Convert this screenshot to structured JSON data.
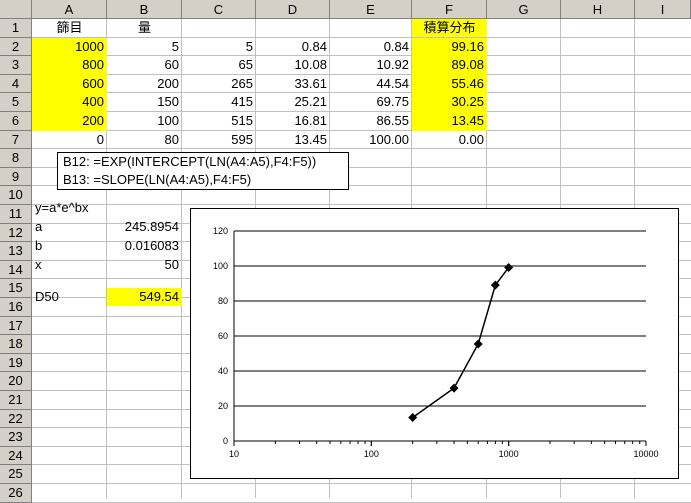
{
  "columns": [
    "A",
    "B",
    "C",
    "D",
    "E",
    "F",
    "G",
    "H",
    "I"
  ],
  "rows": [
    "1",
    "2",
    "3",
    "4",
    "5",
    "6",
    "7",
    "8",
    "9",
    "10",
    "11",
    "12",
    "13",
    "14",
    "15",
    "16",
    "17",
    "18",
    "19",
    "20",
    "21",
    "22",
    "23",
    "24",
    "25",
    "26"
  ],
  "header_row": {
    "A": "篩目",
    "B": "量",
    "F": "積算分布"
  },
  "data_rows": [
    {
      "A": "1000",
      "B": "5",
      "C": "5",
      "D": "0.84",
      "E": "0.84",
      "F": "99.16"
    },
    {
      "A": "800",
      "B": "60",
      "C": "65",
      "D": "10.08",
      "E": "10.92",
      "F": "89.08"
    },
    {
      "A": "600",
      "B": "200",
      "C": "265",
      "D": "33.61",
      "E": "44.54",
      "F": "55.46"
    },
    {
      "A": "400",
      "B": "150",
      "C": "415",
      "D": "25.21",
      "E": "69.75",
      "F": "30.25"
    },
    {
      "A": "200",
      "B": "100",
      "C": "515",
      "D": "16.81",
      "E": "86.55",
      "F": "13.45"
    },
    {
      "A": "0",
      "B": "80",
      "C": "595",
      "D": "13.45",
      "E": "100.00",
      "F": "0.00"
    }
  ],
  "formulas": [
    "B12: =EXP(INTERCEPT(LN(A4:A5),F4:F5))",
    "B13: =SLOPE(LN(A4:A5),F4:F5)"
  ],
  "model": {
    "equation": "y=a*e^bx",
    "a_label": "a",
    "a_value": "245.8954",
    "b_label": "b",
    "b_value": "0.016083",
    "x_label": "x",
    "x_value": "50",
    "d50_label": "D50",
    "d50_value": "549.54"
  },
  "colors": {
    "highlight": "#ffff00",
    "header_bg": "#d4d0c8",
    "grid": "#c0c0c0"
  },
  "chart_data": {
    "type": "line",
    "x_scale": "log",
    "xlim": [
      10,
      10000
    ],
    "ylim": [
      0,
      120
    ],
    "x_ticks": [
      "10",
      "100",
      "1000",
      "10000"
    ],
    "y_ticks": [
      "0",
      "20",
      "40",
      "60",
      "80",
      "100",
      "120"
    ],
    "grid": true,
    "series": [
      {
        "x": [
          200,
          400,
          600,
          800,
          1000
        ],
        "y": [
          13.45,
          30.25,
          55.46,
          89.08,
          99.16
        ],
        "marker": "diamond"
      }
    ]
  }
}
